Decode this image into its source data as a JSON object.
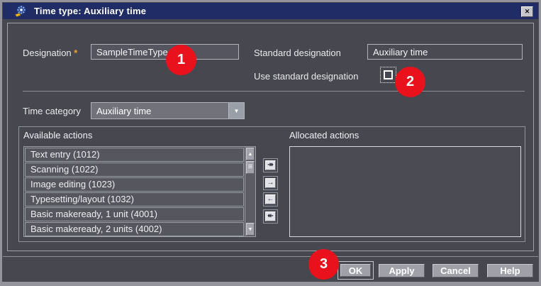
{
  "window": {
    "title": "Time type: Auxiliary time",
    "close_glyph": "✕"
  },
  "form": {
    "designation": {
      "label": "Designation",
      "required_marker": "*",
      "value": "SampleTimeType"
    },
    "standard_designation": {
      "label": "Standard designation",
      "value": "Auxiliary time"
    },
    "use_standard_designation": {
      "label": "Use standard designation",
      "checked": false
    },
    "time_category": {
      "label": "Time category",
      "value": "Auxiliary time",
      "dropdown_glyph": "▼"
    }
  },
  "actions": {
    "available": {
      "label": "Available actions",
      "items": [
        "Text entry (1012)",
        "Scanning (1022)",
        "Image editing (1023)",
        "Typesetting/layout (1032)",
        "Basic makeready, 1 unit (4001)",
        "Basic makeready, 2 units (4002)"
      ]
    },
    "allocated": {
      "label": "Allocated actions",
      "items": []
    },
    "transfer_buttons": {
      "move_all_right": "↠",
      "move_right": "→",
      "move_left": "←",
      "move_all_left": "↞"
    },
    "scrollbar": {
      "up_glyph": "▲",
      "down_glyph": "▼",
      "thumb_glyph": "≡"
    }
  },
  "footer": {
    "ok": "OK",
    "apply": "Apply",
    "cancel": "Cancel",
    "help": "Help"
  },
  "annotations": {
    "badge1": "1",
    "badge2": "2",
    "badge3": "3"
  },
  "colors": {
    "title_bar": "#1f2c66",
    "dialog_bg": "#47474f",
    "badge_red": "#e8111c",
    "required_marker": "#f0a030",
    "button_bg": "#a0a0a9"
  }
}
